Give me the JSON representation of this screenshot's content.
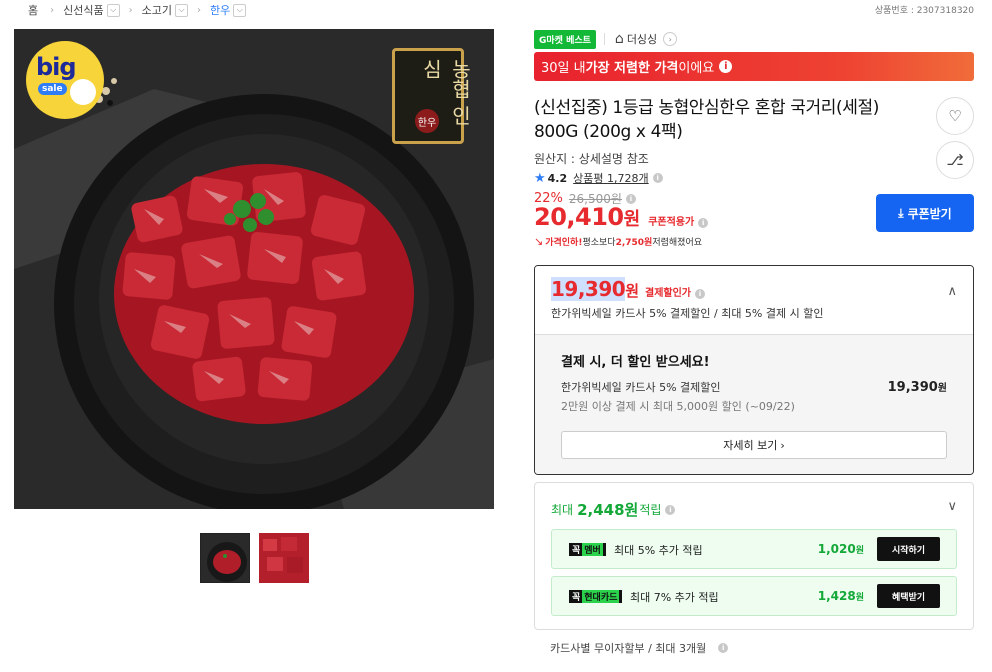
{
  "breadcrumb": [
    {
      "label": "홈",
      "has_dropdown": false
    },
    {
      "label": "신선식품",
      "has_dropdown": true
    },
    {
      "label": "소고기",
      "has_dropdown": true
    },
    {
      "label": "한우",
      "has_dropdown": true,
      "active": true
    }
  ],
  "product_number": "상품번호 : 2307318320",
  "badges": {
    "big_sale_top": "big",
    "big_sale_bottom": "sale",
    "seal_text": "농협 인심",
    "seal_sub": "한우"
  },
  "tags": {
    "best": "G마켓 베스트",
    "store_name": "더싱싱"
  },
  "price_banner": {
    "prefix": "30일 내 ",
    "bold": "가장 저렴한 가격",
    "suffix": "이에요"
  },
  "product": {
    "title": "(신선집중) 1등급 농협안심한우 혼합 국거리(세절) 800G (200g x 4팩)",
    "origin": "원산지 : 상세설명 참조",
    "rating": "4.2",
    "review_label": "상품평",
    "review_count": "1,728개",
    "discount_rate": "22%",
    "original_price": "26,500원",
    "price": "20,410",
    "price_unit": "원",
    "coupon_applied": "쿠폰적용가",
    "cheaper_prefix": "가격인하!",
    "cheaper_mid": " 평소보다 ",
    "cheaper_amount": "2,750원",
    "cheaper_suffix": " 저렴해졌어요",
    "coupon_button": "쿠폰받기"
  },
  "payment": {
    "price": "19,390",
    "price_unit": "원",
    "label": "결제할인가",
    "summary": "한가위빅세일 카드사 5% 결제할인 / 최대 5% 결제 시 할인",
    "more_title": "결제 시, 더 할인 받으세요!",
    "line1": "한가위빅세일 카드사 5% 결제할인",
    "line1_amount": "19,390",
    "line1_unit": "원",
    "line2": "2만원 이상 결제 시 최대 5,000원 할인 (~09/22)",
    "detail_button": "자세히 보기"
  },
  "points": {
    "prefix": "최대",
    "amount": "2,448원",
    "suffix": "적립",
    "rows": [
      {
        "logo_a": "꼭",
        "logo_b": "멤버",
        "text": "최대 5% 추가 적립",
        "amount": "1,020",
        "unit": "원",
        "button": "시작하기"
      },
      {
        "logo_a": "꼭",
        "logo_b": "현대카드",
        "text": "최대 7% 추가 적립",
        "amount": "1,428",
        "unit": "원",
        "button": "혜택받기"
      }
    ]
  },
  "installment": "카드사별 무이자할부 / 최대 3개월",
  "colors": {
    "accent_red": "#e62a2e",
    "accent_blue": "#1565f2",
    "accent_green": "#13a838"
  }
}
